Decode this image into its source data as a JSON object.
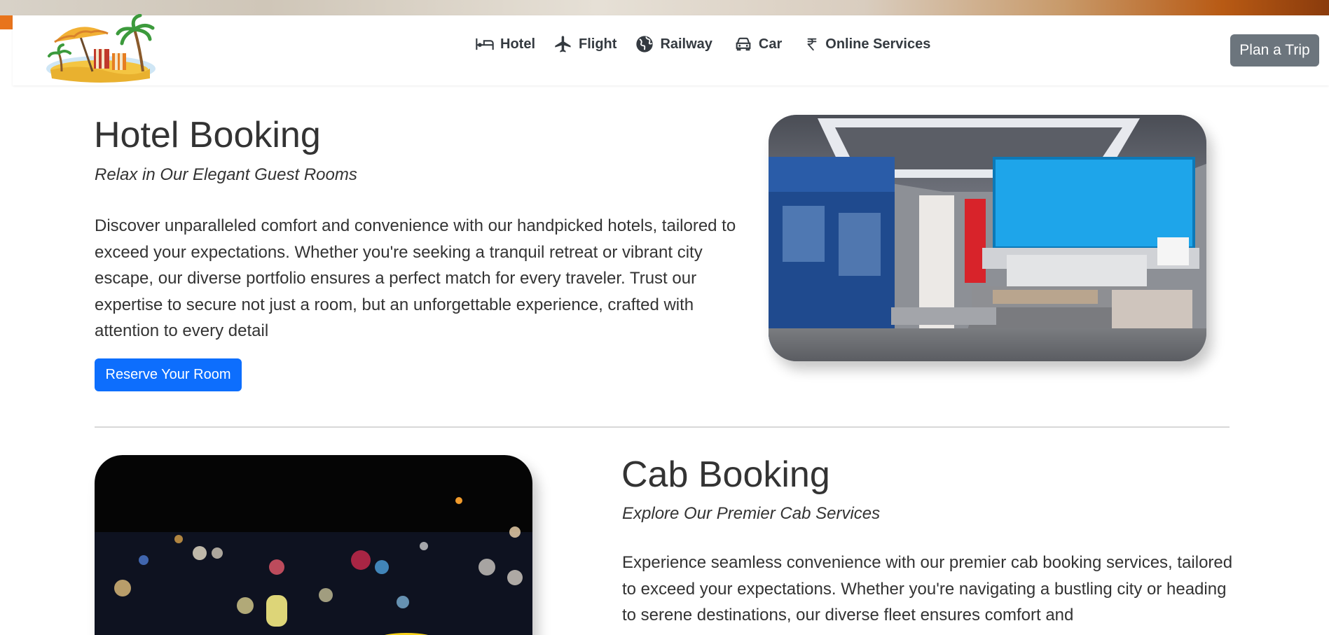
{
  "nav": {
    "items": [
      {
        "label": "Hotel",
        "icon": "bed-icon"
      },
      {
        "label": "Flight",
        "icon": "airplane-icon"
      },
      {
        "label": "Railway",
        "icon": "globe-icon"
      },
      {
        "label": "Car",
        "icon": "car-icon"
      },
      {
        "label": "Online Services",
        "icon": "rupee-icon"
      }
    ],
    "cta_label": "Plan a Trip"
  },
  "hotel": {
    "title": "Hotel Booking",
    "subtitle": "Relax in Our Elegant Guest Rooms",
    "body": "Discover unparalleled comfort and convenience with our handpicked hotels, tailored to exceed your expectations. Whether you're seeking a tranquil retreat or vibrant city escape, our diverse portfolio ensures a perfect match for every traveler. Trust our expertise to secure not just a room, but an unforgettable experience, crafted with attention to every detail",
    "button_label": "Reserve Your Room"
  },
  "cab": {
    "title": "Cab Booking",
    "subtitle": "Explore Our Premier Cab Services",
    "body": "Experience seamless convenience with our premier cab booking services, tailored to exceed your expectations. Whether you're navigating a bustling city or heading to serene destinations, our diverse fleet ensures comfort and"
  },
  "colors": {
    "primary": "#0d6efd",
    "secondary": "#6c757d",
    "text": "#333333"
  }
}
